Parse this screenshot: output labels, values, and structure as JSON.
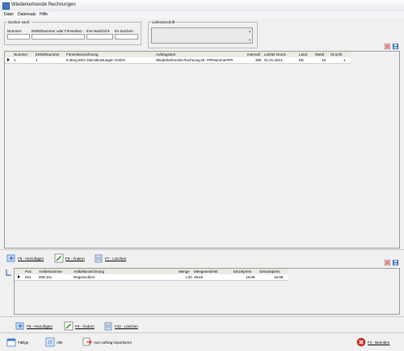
{
  "window": {
    "title": "Wiederkehrende Rechnungen"
  },
  "menu": [
    "Datei",
    "Datensatz",
    "Hilfe"
  ],
  "search": {
    "legend": "Suchen nach:",
    "labels": {
      "nummer": "Nummer:",
      "emis": "EMIS/Nummer oder Firmenbez.:",
      "nachricht": "Ihre Nachricht:",
      "zeichen": "Ihr Zeichen:"
    },
    "values": {
      "nummer": "",
      "emis": "",
      "nachricht": "",
      "zeichen": ""
    }
  },
  "lieferanschrift": {
    "legend": "Lieferanschrift"
  },
  "top_table": {
    "headers": [
      "Nummer",
      "EMIS/Nummer",
      "Firmenbezeichnung",
      "Auftragstext",
      "Intervall",
      "Letzter Druck",
      "Land",
      "MwSt",
      "St.Schl."
    ],
    "rows": [
      {
        "nummer": "1",
        "emis": "1",
        "firma": "K.Berg EDV Dienstleistungen GmbH",
        "text": "Wiederkehrende Rechnung Nr. ###Nummer###",
        "intervall": "365",
        "druck": "01.01.2013",
        "land": "DE",
        "mwst": "19",
        "stschl": "1"
      }
    ]
  },
  "mid_toolbar": {
    "add": "F5 - Hinzufügen",
    "edit": "F6 - Ändern",
    "delete": "F7 - Löschen"
  },
  "bottom_table": {
    "headers": [
      "Pos",
      "Artikelnummer",
      "Artikelbezeichnung",
      "Menge",
      "Mengeneinheit",
      "Einzelpreis",
      "Gesamtpreis"
    ],
    "rows": [
      {
        "pos": "001",
        "artnr": "608.101",
        "bez": "Regenschirm",
        "menge": "1,00",
        "einheit": "Stück",
        "einzel": "19,99",
        "gesamt": "19,99"
      }
    ]
  },
  "bottom_toolbar": {
    "add": "F8 - Hinzufügen",
    "edit": "F9 - Ändern",
    "delete": "F10 - Löschen"
  },
  "footer": {
    "faellige": "Fällige",
    "alle": "Alle",
    "import": "Aus Auftrag importieren",
    "beenden": "F4 - Beenden"
  },
  "colors": {
    "accent": "#3f78c8",
    "delete_red": "#d9342b",
    "edit_green": "#3a9a3a"
  }
}
